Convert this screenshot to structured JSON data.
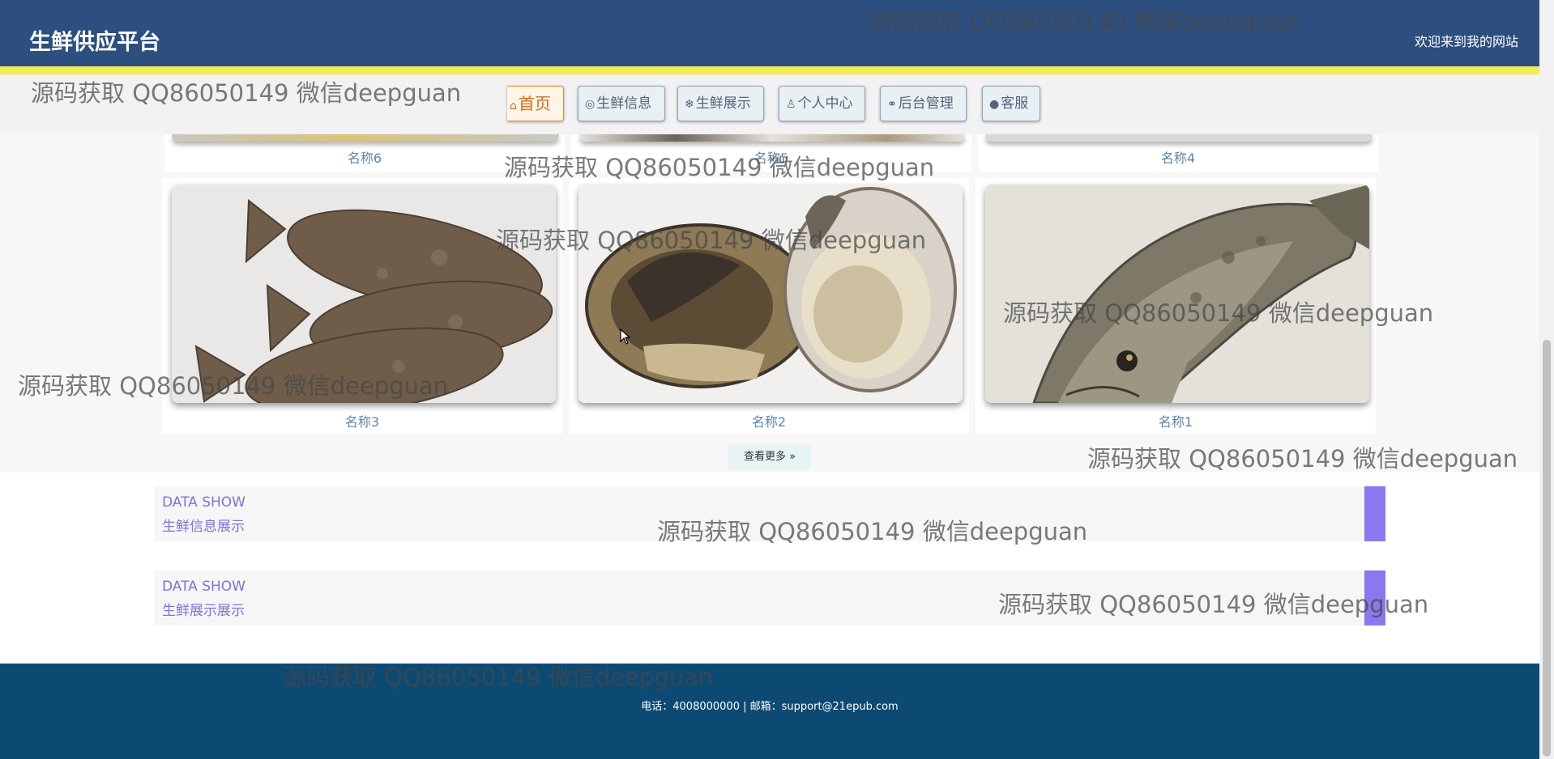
{
  "header": {
    "site_title": "生鲜供应平台",
    "welcome": "欢迎来到我的网站"
  },
  "nav": {
    "home": "首页",
    "fresh_info": "生鲜信息",
    "fresh_show": "生鲜展示",
    "personal_center": "个人中心",
    "admin": "后台管理",
    "service": "客服"
  },
  "gallery": {
    "cut_row": [
      {
        "label": "名称6"
      },
      {
        "label": "名称5"
      },
      {
        "label": "名称4"
      }
    ],
    "cards": [
      {
        "label": "名称3",
        "image": "flounder fish photo"
      },
      {
        "label": "名称2",
        "image": "oyster photo"
      },
      {
        "label": "名称1",
        "image": "fish photo"
      }
    ],
    "more_button": "查看更多"
  },
  "sections": [
    {
      "en": "DATA SHOW",
      "cn": "生鲜信息展示"
    },
    {
      "en": "DATA SHOW",
      "cn": "生鲜展示展示"
    }
  ],
  "footer": {
    "contact": "电话：4008000000 | 邮箱：support@21epub.com"
  },
  "watermark": "源码获取 QQ86050149 微信deepguan",
  "colors": {
    "header_bg": "#2d4f7f",
    "header_stripe": "#f2ec55",
    "footer_bg": "#0d4a73",
    "accent_purple": "#8a78ee",
    "label_blue": "#5d85a8"
  }
}
